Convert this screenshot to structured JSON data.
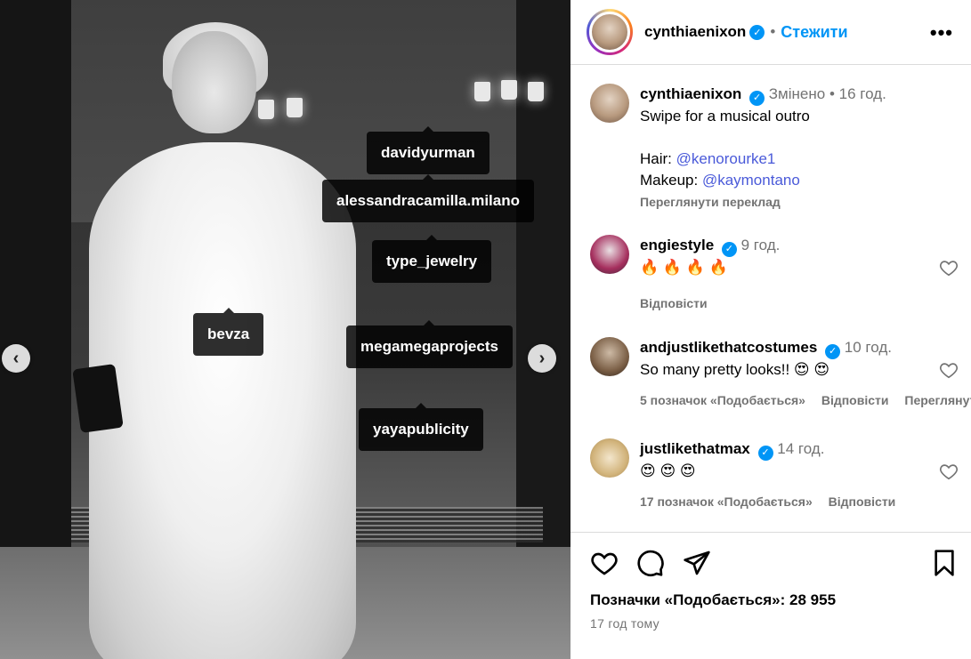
{
  "post": {
    "username": "cynthiaenixon",
    "follow_label": "Стежити",
    "more_label": "•••",
    "tags": [
      "davidyurman",
      "alessandracamilla.milano",
      "type_jewelry",
      "bevza",
      "megamegaprojects",
      "yayapublicity"
    ],
    "nav_prev": "‹",
    "nav_next": "›"
  },
  "caption": {
    "username": "cynthiaenixon",
    "edited": "Змінено",
    "time": "16 год.",
    "line1": "Swipe for a musical outro",
    "hair_label": "Hair: ",
    "hair_handle": "@kenorourke1",
    "makeup_label": "Makeup: ",
    "makeup_handle": "@kaymontano",
    "translate": "Переглянути переклад"
  },
  "comments": [
    {
      "username": "engiestyle",
      "time": "9 год.",
      "text": "🔥 🔥 🔥 🔥",
      "likes": "",
      "reply": "Відповісти",
      "extra": ""
    },
    {
      "username": "andjustlikethatcostumes",
      "time": "10 год.",
      "text": "So many pretty looks!! 😍 😍",
      "likes": "5 позначок «Подобається»",
      "reply": "Відповісти",
      "extra": "Переглянути переклад"
    },
    {
      "username": "justlikethatmax",
      "time": "14 год.",
      "text": "😍 😍 😍",
      "likes": "17 позначок «Подобається»",
      "reply": "Відповісти",
      "extra": ""
    }
  ],
  "footer": {
    "likes": "Позначки «Подобається»: 28 955",
    "ago": "17 год тому"
  },
  "icons": {
    "verified": "verified-badge-icon",
    "heart": "heart-icon",
    "comment": "comment-icon",
    "share": "share-icon",
    "bookmark": "bookmark-icon"
  },
  "colors": {
    "accent": "#0095f6",
    "muted": "#737373",
    "link": "#4a5ad9"
  }
}
